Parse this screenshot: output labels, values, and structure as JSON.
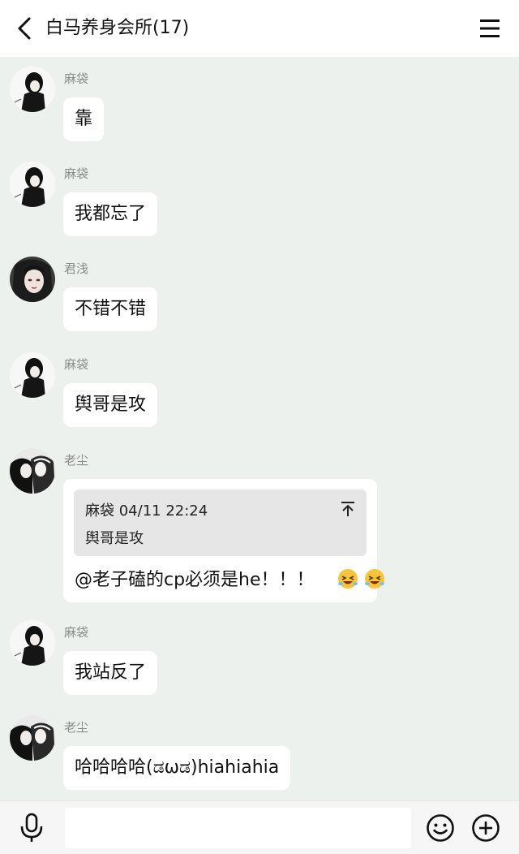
{
  "header": {
    "title": "白马养身会所(17)"
  },
  "messages": [
    {
      "sender": "麻袋",
      "text": "靠",
      "avatar": "boy-dark-avatar"
    },
    {
      "sender": "麻袋",
      "text": "我都忘了",
      "avatar": "boy-dark-avatar"
    },
    {
      "sender": "君浅",
      "text": "不错不错",
      "avatar": "girl-portrait-avatar"
    },
    {
      "sender": "麻袋",
      "text": "舆哥是攻",
      "avatar": "boy-dark-avatar"
    },
    {
      "sender": "老尘",
      "avatar": "couple-manga-avatar",
      "quote": {
        "meta": "麻袋 04/11 22:24",
        "text": "舆哥是攻"
      },
      "text": "@老子磕的cp必须是he！！！"
    },
    {
      "sender": "麻袋",
      "text": "我站反了",
      "avatar": "boy-dark-avatar"
    },
    {
      "sender": "老尘",
      "text": "哈哈哈哈(ಡωಡ)hiahiahia",
      "avatar": "couple-manga-avatar"
    }
  ],
  "input": {
    "placeholder": ""
  },
  "icons": {
    "back": "chevron-left-icon",
    "menu": "hamburger-icon",
    "mic": "microphone-icon",
    "emoji": "smiley-icon",
    "plus": "plus-circle-icon",
    "pin": "pin-top-icon"
  }
}
